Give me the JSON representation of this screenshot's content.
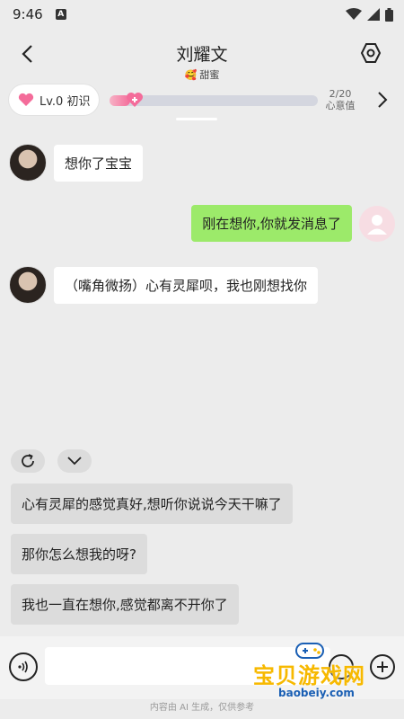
{
  "status_bar": {
    "time": "9:46",
    "app_icon_label": "A"
  },
  "header": {
    "title": "刘耀文",
    "subtitle_emoji": "🥰",
    "subtitle": "甜蜜"
  },
  "level": {
    "label": "Lv.0 初识",
    "progress": 0.1,
    "progress_text": "2/20",
    "progress_caption": "心意值"
  },
  "messages": [
    {
      "side": "left",
      "text": "想你了宝宝"
    },
    {
      "side": "right",
      "text": "刚在想你,你就发消息了"
    },
    {
      "side": "left",
      "text": "（嘴角微扬）心有灵犀呗，我也刚想找你"
    }
  ],
  "suggestions": [
    "心有灵犀的感觉真好,想听你说说今天干嘛了",
    "那你怎么想我的呀?",
    "我也一直在想你,感觉都离不开你了"
  ],
  "input": {
    "placeholder": ""
  },
  "disclaimer": "内容由 AI 生成，仅供参考",
  "watermark": {
    "text": "宝贝游戏网",
    "url": "baobeiy.com"
  },
  "colors": {
    "accent_pink": "#f46c9a",
    "bubble_green": "#9cea6a",
    "watermark_yellow": "#f7b900"
  }
}
